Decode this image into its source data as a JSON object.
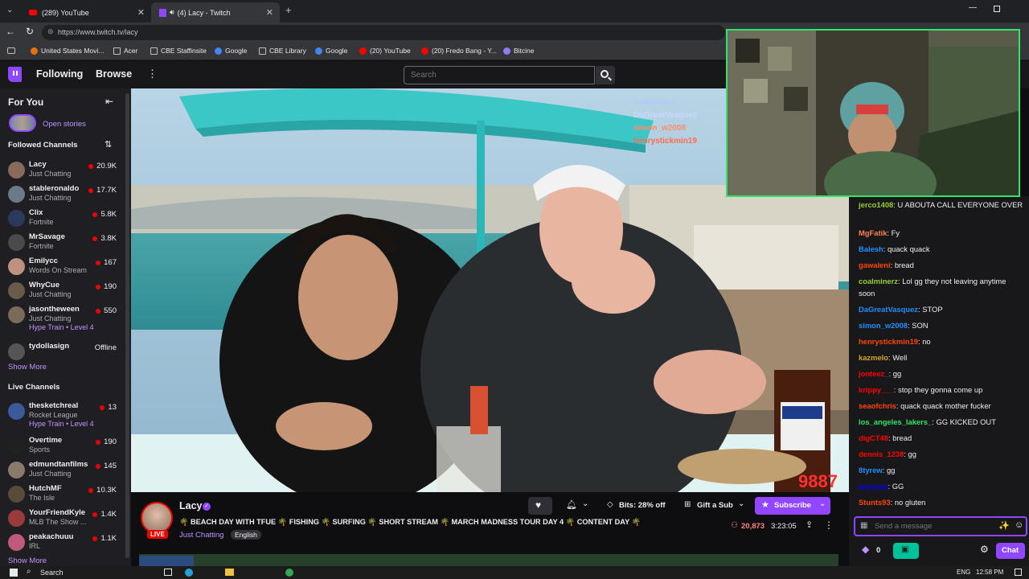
{
  "browser": {
    "tabs": [
      {
        "title": "(289) YouTube"
      },
      {
        "title": "(4) Lacy - Twitch"
      }
    ],
    "url": "https://www.twitch.tv/lacy",
    "bookmarks": [
      {
        "label": "United States Movi...",
        "color": "#e8710a"
      },
      {
        "label": "Acer",
        "color": "#9aa0a6"
      },
      {
        "label": "CBE Staffinsite",
        "color": "#9aa0a6"
      },
      {
        "label": "Google",
        "color": "#4285f4"
      },
      {
        "label": "CBE Library",
        "color": "#9aa0a6"
      },
      {
        "label": "Google",
        "color": "#4285f4"
      },
      {
        "label": "(20) YouTube",
        "color": "#ff0000"
      },
      {
        "label": "(20) Fredo Bang - Y...",
        "color": "#ff0000"
      },
      {
        "label": "Bitcine",
        "color": "#8e7cf0"
      }
    ]
  },
  "nav": {
    "following": "Following",
    "browse": "Browse",
    "search_placeholder": "Search"
  },
  "sidebar": {
    "for_you": "For You",
    "open_stories": "Open stories",
    "followed_header": "Followed Channels",
    "followed": [
      {
        "name": "Lacy",
        "game": "Just Chatting",
        "viewers": "20.9K",
        "color": "#8a6a5a"
      },
      {
        "name": "stableronaldo",
        "game": "Just Chatting",
        "viewers": "17.7K",
        "color": "#6a7a8a"
      },
      {
        "name": "Clix",
        "game": "Fortnite",
        "viewers": "5.8K",
        "color": "#2a3a5a"
      },
      {
        "name": "MrSavage",
        "game": "Fortnite",
        "viewers": "3.8K",
        "color": "#4a4a4a"
      },
      {
        "name": "Emilycc",
        "game": "Words On Stream",
        "viewers": "167",
        "color": "#c09080"
      },
      {
        "name": "WhyCue",
        "game": "Just Chatting",
        "viewers": "190",
        "color": "#6a5a4a"
      },
      {
        "name": "jasontheween",
        "game": "Just Chatting",
        "viewers": "550",
        "hype": "Hype Train • Level 4",
        "color": "#7a6a5a"
      },
      {
        "name": "tydollasign",
        "game": "",
        "viewers": "Offline",
        "color": "#555555"
      }
    ],
    "show_more_1": "Show More",
    "live_header": "Live Channels",
    "live": [
      {
        "name": "thesketchreal",
        "game": "Rocket League",
        "viewers": "13",
        "hype": "Hype Train • Level 4",
        "color": "#3a5a9a"
      },
      {
        "name": "Overtime",
        "game": "Sports",
        "viewers": "190",
        "color": "#202020"
      },
      {
        "name": "edmundtanfilms",
        "game": "Just Chatting",
        "viewers": "145",
        "color": "#8a7a6a"
      },
      {
        "name": "HutchMF",
        "game": "The Isle",
        "viewers": "10.3K",
        "color": "#5a4a3a"
      },
      {
        "name": "YourFriendKyle",
        "game": "MLB The Show ...",
        "viewers": "1.4K",
        "color": "#9a3a3a"
      },
      {
        "name": "peakachuuu",
        "game": "IRL",
        "viewers": "1.1K",
        "color": "#c05a7a"
      }
    ],
    "show_more_2": "Show More"
  },
  "video": {
    "bits_counter": "9887",
    "overlay_names": [
      "coalminerz",
      "DaGreatVasquez",
      "simon_w2008",
      "henrystickmin19"
    ]
  },
  "stream": {
    "streamer": "Lacy",
    "live_badge": "LIVE",
    "title": "🌴 BEACH DAY WITH TFUE 🌴 FISHING 🌴 SURFING 🌴 SHORT STREAM 🌴 MARCH MADNESS TOUR DAY 4 🌴 CONTENT DAY 🌴",
    "category": "Just Chatting",
    "tag": "English",
    "bits": "Bits: 28% off",
    "gift": "Gift a Sub",
    "subscribe": "Subscribe",
    "viewers": "20,873",
    "uptime": "3:23:05"
  },
  "chat": {
    "messages": [
      {
        "user": "jerco1408",
        "color": "#9acd32",
        "text": "U ABOUTA CALL EVERYONE OVER"
      },
      {
        "user": "MgFatik",
        "color": "#ff7f50",
        "text": "Fy"
      },
      {
        "user": "Balesh",
        "color": "#1e90ff",
        "text": "quack quack"
      },
      {
        "user": "gawaleni",
        "color": "#ff4500",
        "text": "bread"
      },
      {
        "user": "coalminerz",
        "color": "#9acd32",
        "text": "Lol gg they not leaving anytime soon"
      },
      {
        "user": "DaGreatVasquez",
        "color": "#1e90ff",
        "text": "STOP"
      },
      {
        "user": "simon_w2008",
        "color": "#1e90ff",
        "text": "SON"
      },
      {
        "user": "henrystickmin19",
        "color": "#ff4500",
        "text": "no"
      },
      {
        "user": "kazmelo",
        "color": "#daa520",
        "text": "Well"
      },
      {
        "user": "jonteez_",
        "color": "#ff0000",
        "text": "gg"
      },
      {
        "user": "krippy___",
        "color": "#ff0000",
        "text": "stop they gonna come up"
      },
      {
        "user": "seaofchris",
        "color": "#ff4500",
        "text": "quack quack mother fucker"
      },
      {
        "user": "los_angeles_lakers_",
        "color": "#2ee567",
        "text": "GG KICKED OUT"
      },
      {
        "user": "digCT48",
        "color": "#ff0000",
        "text": "bread"
      },
      {
        "user": "dennis_1238",
        "color": "#ff0000",
        "text": "gg"
      },
      {
        "user": "8tyrew",
        "color": "#1e90ff",
        "text": "gg"
      },
      {
        "user": "ayyyyyy",
        "color": "#0000ff",
        "text": "GG"
      },
      {
        "user": "Stunts93",
        "color": "#ff4500",
        "text": "no gluten"
      }
    ],
    "input_placeholder": "Send a message",
    "points": "0",
    "chat_button": "Chat"
  },
  "taskbar": {
    "search": "Search",
    "lang": "ENG",
    "time": "12:58 PM"
  }
}
